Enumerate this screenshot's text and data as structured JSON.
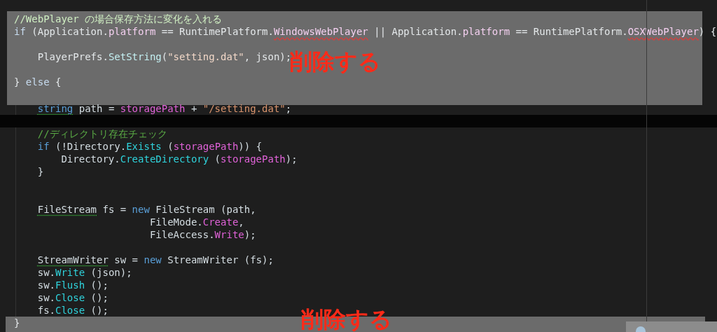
{
  "sections": [
    {
      "kind": "masked",
      "label": "削除する",
      "lines": [
        {
          "current": false,
          "tokens": [
            {
              "kind": "comment",
              "text": "//WebPlayer の場合保存方法に変化を入れる"
            }
          ]
        },
        {
          "current": false,
          "tokens": [
            {
              "kind": "keyword",
              "text": "if"
            },
            {
              "kind": "plain",
              "text": " (Application."
            },
            {
              "kind": "property",
              "text": "platform"
            },
            {
              "kind": "plain",
              "text": " == RuntimePlatform."
            },
            {
              "kind": "property",
              "text": "WindowsWebPlayer",
              "error": true
            },
            {
              "kind": "plain",
              "text": " || Application."
            },
            {
              "kind": "property",
              "text": "platform"
            },
            {
              "kind": "plain",
              "text": " == RuntimePlatform."
            },
            {
              "kind": "property",
              "text": "OSXWebPlayer",
              "error": true
            },
            {
              "kind": "plain",
              "text": ") {"
            }
          ]
        },
        {
          "current": false
        },
        {
          "current": false,
          "tokens": [
            {
              "kind": "plain",
              "text": "    PlayerPrefs."
            },
            {
              "kind": "method",
              "text": "SetString"
            },
            {
              "kind": "plain",
              "text": "("
            },
            {
              "kind": "string",
              "text": "\"setting.dat\""
            },
            {
              "kind": "plain",
              "text": ", json);"
            }
          ]
        },
        {
          "current": false
        },
        {
          "current": false,
          "tokens": [
            {
              "kind": "plain",
              "text": "} "
            },
            {
              "kind": "keyword",
              "text": "else"
            },
            {
              "kind": "plain",
              "text": " {"
            }
          ]
        },
        {
          "current": false
        }
      ]
    },
    {
      "kind": "plain",
      "lines": [
        {
          "current": false,
          "tokens": [
            {
              "kind": "keyword",
              "text": "    string",
              "warning": true
            },
            {
              "kind": "plain",
              "text": " path = "
            },
            {
              "kind": "property",
              "text": "storagePath"
            },
            {
              "kind": "plain",
              "text": " + "
            },
            {
              "kind": "string",
              "text": "\"/setting.dat\""
            },
            {
              "kind": "plain",
              "text": ";"
            }
          ]
        },
        {
          "current": true
        },
        {
          "current": false,
          "tokens": [
            {
              "kind": "comment",
              "text": "    //ディレクトリ存在チェック"
            }
          ]
        },
        {
          "current": false,
          "tokens": [
            {
              "kind": "keyword",
              "text": "    if"
            },
            {
              "kind": "plain",
              "text": " (!Directory."
            },
            {
              "kind": "method",
              "text": "Exists"
            },
            {
              "kind": "plain",
              "text": " ("
            },
            {
              "kind": "property",
              "text": "storagePath"
            },
            {
              "kind": "plain",
              "text": ")) {"
            }
          ]
        },
        {
          "current": false,
          "tokens": [
            {
              "kind": "plain",
              "text": "        Directory."
            },
            {
              "kind": "method",
              "text": "CreateDirectory"
            },
            {
              "kind": "plain",
              "text": " ("
            },
            {
              "kind": "property",
              "text": "storagePath"
            },
            {
              "kind": "plain",
              "text": ");"
            }
          ]
        },
        {
          "current": false,
          "tokens": [
            {
              "kind": "plain",
              "text": "    }"
            }
          ]
        },
        {
          "current": false
        },
        {
          "current": false
        },
        {
          "current": false,
          "tokens": [
            {
              "kind": "plain",
              "text": "    FileStream",
              "warning": true
            },
            {
              "kind": "plain",
              "text": " fs = "
            },
            {
              "kind": "keyword",
              "text": "new"
            },
            {
              "kind": "plain",
              "text": " FileStream (path,"
            }
          ]
        },
        {
          "current": false,
          "tokens": [
            {
              "kind": "plain",
              "text": "                       FileMode."
            },
            {
              "kind": "property",
              "text": "Create"
            },
            {
              "kind": "plain",
              "text": ","
            }
          ]
        },
        {
          "current": false,
          "tokens": [
            {
              "kind": "plain",
              "text": "                       FileAccess."
            },
            {
              "kind": "property",
              "text": "Write"
            },
            {
              "kind": "plain",
              "text": ");"
            }
          ]
        },
        {
          "current": false
        },
        {
          "current": false,
          "tokens": [
            {
              "kind": "plain",
              "text": "    StreamWriter",
              "warning": true
            },
            {
              "kind": "plain",
              "text": " sw = "
            },
            {
              "kind": "keyword",
              "text": "new"
            },
            {
              "kind": "plain",
              "text": " StreamWriter (fs);"
            }
          ]
        },
        {
          "current": false,
          "tokens": [
            {
              "kind": "plain",
              "text": "    sw."
            },
            {
              "kind": "method",
              "text": "Write"
            },
            {
              "kind": "plain",
              "text": " (json);"
            }
          ]
        },
        {
          "current": false,
          "tokens": [
            {
              "kind": "plain",
              "text": "    sw."
            },
            {
              "kind": "method",
              "text": "Flush"
            },
            {
              "kind": "plain",
              "text": " ();"
            }
          ]
        },
        {
          "current": false,
          "tokens": [
            {
              "kind": "plain",
              "text": "    sw."
            },
            {
              "kind": "method",
              "text": "Close"
            },
            {
              "kind": "plain",
              "text": " ();"
            }
          ]
        },
        {
          "current": false,
          "tokens": [
            {
              "kind": "plain",
              "text": "    fs."
            },
            {
              "kind": "method",
              "text": "Close"
            },
            {
              "kind": "plain",
              "text": " ();"
            }
          ]
        }
      ]
    },
    {
      "kind": "masked",
      "label": "削除する",
      "lines": [
        {
          "current": false,
          "tokens": [
            {
              "kind": "plain",
              "text": "}"
            }
          ]
        }
      ]
    }
  ]
}
